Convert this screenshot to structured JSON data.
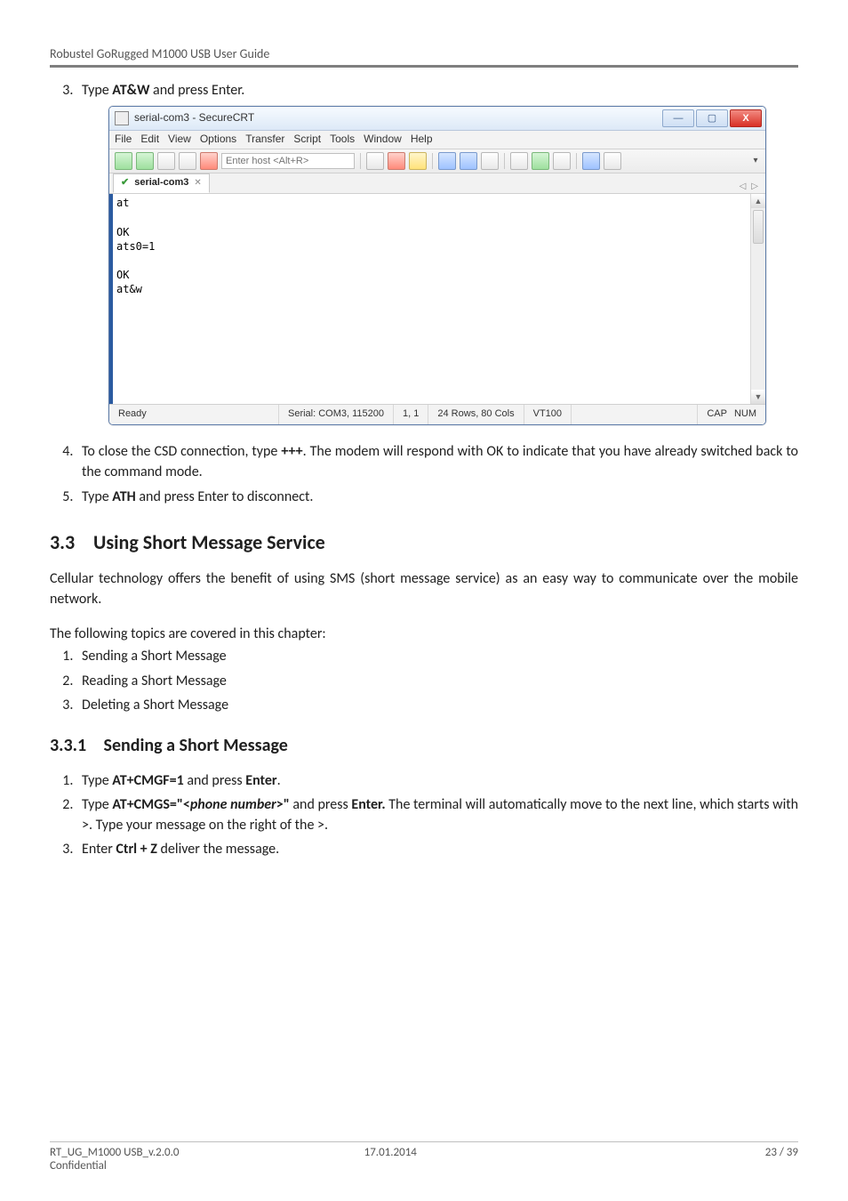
{
  "header": {
    "running_head": "Robustel GoRugged M1000 USB User Guide"
  },
  "step3": {
    "prefix": "Type ",
    "cmd": "AT&W",
    "suffix": " and press Enter."
  },
  "crt": {
    "title": "serial-com3 - SecureCRT",
    "menubar": [
      "File",
      "Edit",
      "View",
      "Options",
      "Transfer",
      "Script",
      "Tools",
      "Window",
      "Help"
    ],
    "host_placeholder": "Enter host <Alt+R>",
    "tab_label": "serial-com3",
    "terminal_lines": "at\n\nOK\nats0=1\n\nOK\nat&w",
    "status": {
      "ready": "Ready",
      "port": "Serial: COM3, 115200",
      "cursor": "1,  1",
      "size": "24 Rows, 80 Cols",
      "emu": "VT100",
      "caps": "CAP",
      "num": "NUM"
    }
  },
  "step4": {
    "prefix": "To close the CSD connection, type ",
    "cmd": "+++",
    "suffix": ". The modem will respond with OK to indicate that you have already switched back to the command mode."
  },
  "step5": {
    "prefix": "Type ",
    "cmd": "ATH",
    "suffix": " and press Enter to disconnect."
  },
  "section33": {
    "num": "3.3",
    "title": "Using Short Message Service"
  },
  "para33a": "Cellular technology offers the benefit of using SMS (short message service) as an easy way to communicate over the mobile network.",
  "para33b": "The following topics are covered in this chapter:",
  "topics": {
    "t1": "Sending a Short Message",
    "t2": "Reading a Short Message",
    "t3": "Deleting a Short Message"
  },
  "section331": {
    "num": "3.3.1",
    "title": "Sending a Short Message"
  },
  "send_steps": {
    "s1": {
      "prefix": "Type ",
      "cmd": "AT+CMGF=1",
      "mid": " and press ",
      "enter": "Enter",
      "suffix": "."
    },
    "s2": {
      "prefix": "Type ",
      "cmd_a": "AT+CMGS=\"<",
      "cmd_b": "phone number",
      "cmd_c": ">\"",
      "mid": " and press ",
      "enter": "Enter.",
      "suffix": " The terminal will automatically move to the next line, which starts with >. Type your message on the right of the >."
    },
    "s3": {
      "prefix": "Enter ",
      "cmd": "Ctrl + Z",
      "suffix": " deliver the message."
    }
  },
  "footer": {
    "doc": "RT_UG_M1000 USB_v.2.0.0",
    "conf": "Confidential",
    "date": "17.01.2014",
    "page": "23 / 39"
  }
}
